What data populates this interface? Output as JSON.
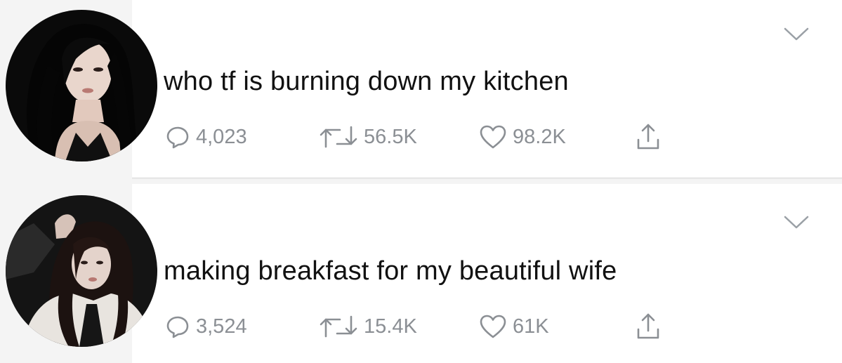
{
  "colors": {
    "text": "#111111",
    "action_gray": "#8b8f94",
    "card_bg": "#ffffff",
    "page_bg": "#f4f4f4"
  },
  "tweets": [
    {
      "text": "who tf is burning down my kitchen",
      "replies": "4,023",
      "retweets": "56.5K",
      "likes": "98.2K"
    },
    {
      "text": "making breakfast for my beautiful wife",
      "replies": "3,524",
      "retweets": "15.4K",
      "likes": "61K"
    }
  ],
  "icons": {
    "reply": "reply-bubble-icon",
    "retweet": "retweet-icon",
    "like": "heart-icon",
    "share": "share-upload-icon",
    "menu": "chevron-down-icon"
  }
}
